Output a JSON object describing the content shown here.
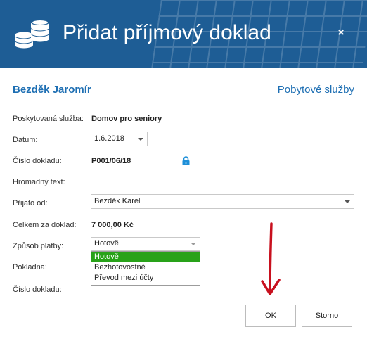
{
  "dialog": {
    "title": "Přidat příjmový doklad",
    "close_label": "×"
  },
  "client": {
    "name": "Bezděk Jaromír",
    "service_type": "Pobytové služby"
  },
  "form": {
    "service_label": "Poskytovaná služba:",
    "service_value": "Domov pro seniory",
    "date_label": "Datum:",
    "date_value": "1.6.2018",
    "doc_number_label": "Číslo dokladu:",
    "doc_number_value": "P001/06/18",
    "bulk_text_label": "Hromadný text:",
    "bulk_text_value": "",
    "received_from_label": "Přijato od:",
    "received_from_value": "Bezděk Karel",
    "total_label": "Celkem za doklad:",
    "total_value": "7 000,00 Kč",
    "payment_method_label": "Způsob platby:",
    "payment_method_value": "Hotově",
    "payment_options": [
      "Hotově",
      "Bezhotovostně",
      "Převod mezi účty"
    ],
    "cash_register_label": "Pokladna:",
    "doc_number2_label": "Číslo dokladu:"
  },
  "buttons": {
    "ok_label": "OK",
    "cancel_label": "Storno"
  },
  "colors": {
    "header_bg": "#1e5d95",
    "accent": "#1e6fb3",
    "selected_option": "#28a219",
    "annotation_arrow": "#c8101e"
  }
}
